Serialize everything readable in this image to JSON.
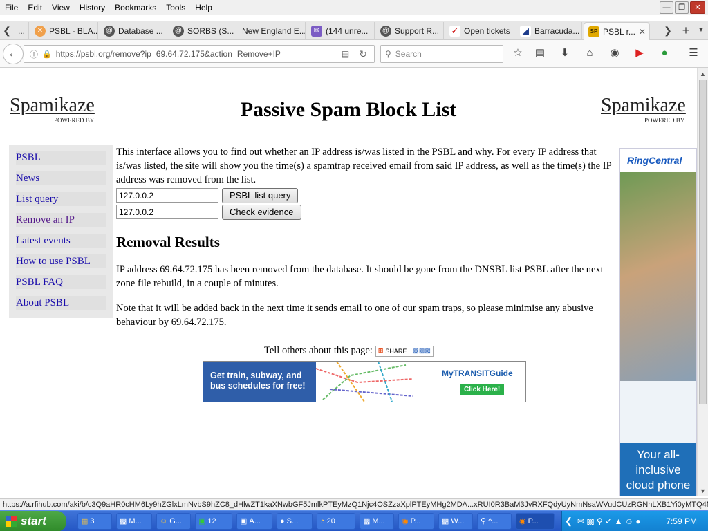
{
  "menu": [
    "File",
    "Edit",
    "View",
    "History",
    "Bookmarks",
    "Tools",
    "Help"
  ],
  "tabs": [
    {
      "label": "..."
    },
    {
      "label": "PSBL - BLA..."
    },
    {
      "label": "Database ..."
    },
    {
      "label": "SORBS (S..."
    },
    {
      "label": "New England E..."
    },
    {
      "label": "(144 unre..."
    },
    {
      "label": "Support R..."
    },
    {
      "label": "Open tickets"
    },
    {
      "label": "Barracuda..."
    },
    {
      "label": "PSBL r..."
    }
  ],
  "nav": {
    "url": "https://psbl.org/remove?ip=69.64.72.175&action=Remove+IP",
    "search_placeholder": "Search"
  },
  "page": {
    "logo_left": "Spamikaze",
    "powered_left": "POWERED BY",
    "logo_right": "Spamikaze",
    "powered_right": "POWERED BY",
    "title": "Passive Spam Block List",
    "sidebar": [
      {
        "label": "PSBL"
      },
      {
        "label": "News"
      },
      {
        "label": "List query"
      },
      {
        "label": "Remove an IP"
      },
      {
        "label": "Latest events"
      },
      {
        "label": "How to use PSBL"
      },
      {
        "label": "PSBL FAQ"
      },
      {
        "label": "About PSBL"
      }
    ],
    "intro": "This interface allows you to find out whether an IP address is/was listed in the PSBL and why. For every IP address that is/was listed, the site will show you the time(s) a spamtrap received email from said IP address, as well as the time(s) the IP address was removed from the list.",
    "query_value_1": "127.0.0.2",
    "query_button_1": "PSBL list query",
    "query_value_2": "127.0.0.2",
    "query_button_2": "Check evidence",
    "results_heading": "Removal Results",
    "result_p1": "IP address 69.64.72.175 has been removed from the database. It should be gone from the DNSBL list PSBL after the next zone file rebuild, in a couple of minutes.",
    "result_p2": "Note that it will be added back in the next time it sends email to one of our spam traps, so please minimise any abusive behaviour by 69.64.72.175.",
    "tell_others": "Tell others about this page:",
    "share_label": "SHARE",
    "banner_text": "Get train, subway, and bus schedules for free!",
    "banner_brand": "MyTRANSITGuide",
    "banner_cta": "Click Here!",
    "ad_brand": "RingCentral",
    "ad_text": "Your all-inclusive cloud phone"
  },
  "status_url": "https://a.rfihub.com/aki/b/c3Q9aHR0cHM6Ly9hZGlxLmNvbS9hZC8_dHlwZT1kaXNwbGF5JmlkPTEyMzQ1Njc4OSZzaXplPTEyMHg2MDA...xRUI0R3BaM3JvRXFQdyUyNmNsaWVudCUzRGNhLXB1Yi0yMTQ4MTE1Nzc0NDQyNzQ0JTI2YWR1cmwlM0Q.",
  "taskbar": {
    "start": "start",
    "items": [
      {
        "label": "3"
      },
      {
        "label": "M..."
      },
      {
        "label": "G..."
      },
      {
        "label": "12"
      },
      {
        "label": "A..."
      },
      {
        "label": "S..."
      },
      {
        "label": "20"
      },
      {
        "label": "M..."
      },
      {
        "label": "P..."
      },
      {
        "label": "W..."
      },
      {
        "label": "^..."
      },
      {
        "label": "P..."
      }
    ],
    "clock": "7:59 PM"
  },
  "colors": {
    "link": "#1a0dab",
    "visited": "#551a8b",
    "taskbar": "#2456c4",
    "start": "#3c9a35"
  }
}
